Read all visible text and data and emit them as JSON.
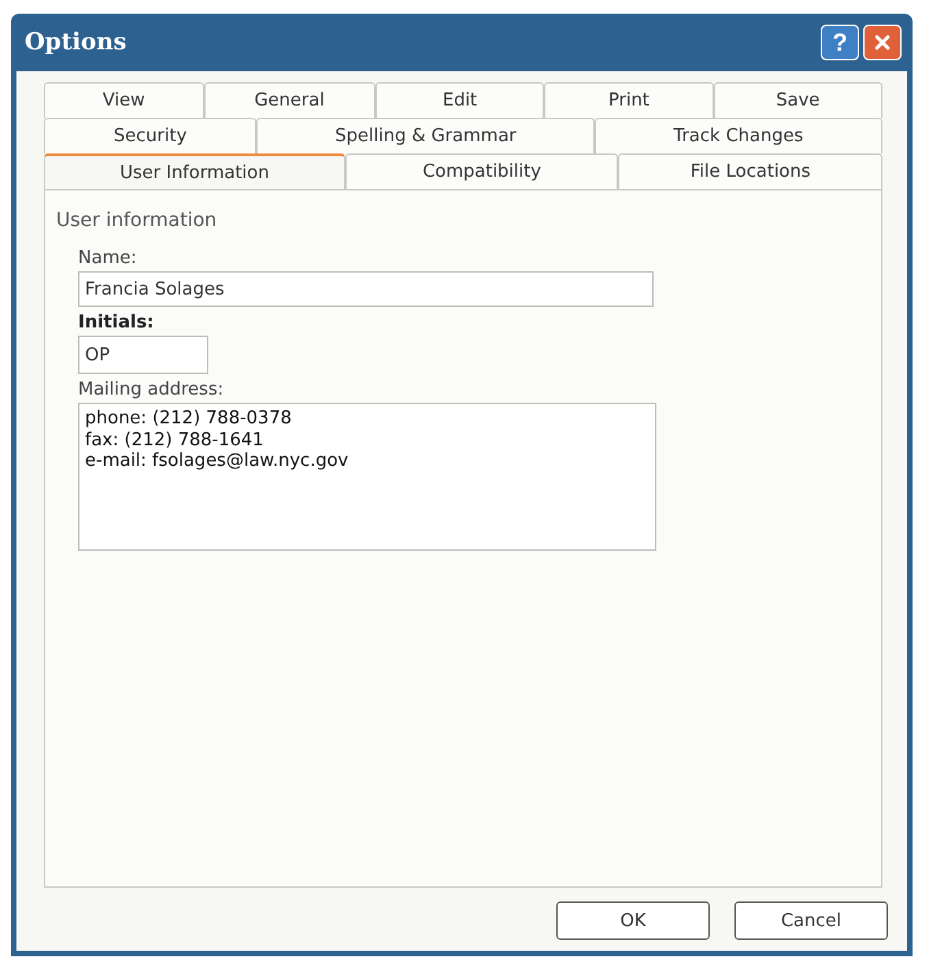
{
  "window": {
    "title": "Options",
    "help_button": "?"
  },
  "tab_rows": [
    [
      {
        "label": "View",
        "selected": false
      },
      {
        "label": "General",
        "selected": false
      },
      {
        "label": "Edit",
        "selected": false
      },
      {
        "label": "Print",
        "selected": false
      },
      {
        "label": "Save",
        "selected": false
      }
    ],
    [
      {
        "label": "Security",
        "selected": false
      },
      {
        "label": "Spelling & Grammar",
        "selected": false
      },
      {
        "label": "Track Changes",
        "selected": false
      }
    ],
    [
      {
        "label": "User Information",
        "selected": true
      },
      {
        "label": "Compatibility",
        "selected": false
      },
      {
        "label": "File Locations",
        "selected": false
      }
    ]
  ],
  "group": {
    "title": "User information",
    "name": {
      "label": "Name:",
      "value": "Francia Solages"
    },
    "initials": {
      "label": "Initials:",
      "value": "OP"
    },
    "mailing_address": {
      "label": "Mailing address:",
      "value": "phone: (212) 788-0378\nfax: (212) 788-1641\ne-mail: fsolages@law.nyc.gov"
    }
  },
  "buttons": [
    "OK",
    "Cancel"
  ]
}
